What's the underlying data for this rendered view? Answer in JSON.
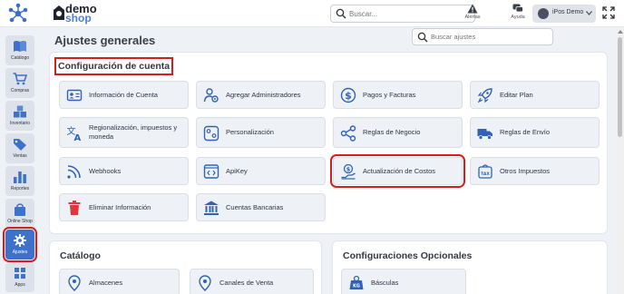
{
  "header": {
    "logo_demo": "demo",
    "logo_shop": "shop",
    "search_placeholder": "Buscar...",
    "alerts_label": "Alertas",
    "help_label": "Ayuda",
    "user_name": "iPos Demo"
  },
  "sidebar": {
    "items": [
      {
        "label": "Catálogo",
        "icon": "book-icon"
      },
      {
        "label": "Compras",
        "icon": "cart-icon"
      },
      {
        "label": "Inventario",
        "icon": "boxes-icon"
      },
      {
        "label": "Ventas",
        "icon": "tag-icon"
      },
      {
        "label": "Reportes",
        "icon": "bar-chart-icon"
      },
      {
        "label": "Online Shop",
        "icon": "shop-bag-icon"
      },
      {
        "label": "Ajustes",
        "icon": "gear-icon",
        "active": true
      },
      {
        "label": "Apps",
        "icon": "apps-icon"
      }
    ]
  },
  "main": {
    "title": "Ajustes generales",
    "search_placeholder": "Buscar ajustes",
    "account_section": {
      "title": "Configuración de cuenta",
      "tiles": [
        {
          "label": "Información de Cuenta",
          "icon": "id-card-icon"
        },
        {
          "label": "Agregar Administradores",
          "icon": "user-gear-icon"
        },
        {
          "label": "Pagos y Facturas",
          "icon": "dollar-circle-icon"
        },
        {
          "label": "Editar Plan",
          "icon": "rocket-icon"
        },
        {
          "label": "Regionalización, impuestos y moneda",
          "icon": "translate-icon"
        },
        {
          "label": "Personalización",
          "icon": "toggles-icon"
        },
        {
          "label": "Reglas de Negocio",
          "icon": "share-nodes-icon"
        },
        {
          "label": "Reglas de Envío",
          "icon": "truck-icon"
        },
        {
          "label": "Webhooks",
          "icon": "wifi-icon"
        },
        {
          "label": "ApiKey",
          "icon": "code-icon"
        },
        {
          "label": "Actualización de Costos",
          "icon": "cost-update-icon",
          "highlighted": true
        },
        {
          "label": "Otros Impuestos",
          "icon": "tax-icon"
        },
        {
          "label": "Eliminar Información",
          "icon": "trash-icon"
        },
        {
          "label": "Cuentas Bancarias",
          "icon": "bank-icon"
        }
      ]
    },
    "catalog_section": {
      "title": "Catálogo",
      "tiles": [
        {
          "label": "Almacenes",
          "icon": "location-pin-icon"
        },
        {
          "label": "Canales de Venta",
          "icon": "location-pin-icon"
        }
      ]
    },
    "optional_section": {
      "title": "Configuraciones Opcionales",
      "tiles": [
        {
          "label": "Básculas",
          "icon": "scale-icon"
        }
      ]
    }
  },
  "colors": {
    "accent": "#3e71c9",
    "highlight": "#d61d1d",
    "icon": "#2f63b8"
  }
}
